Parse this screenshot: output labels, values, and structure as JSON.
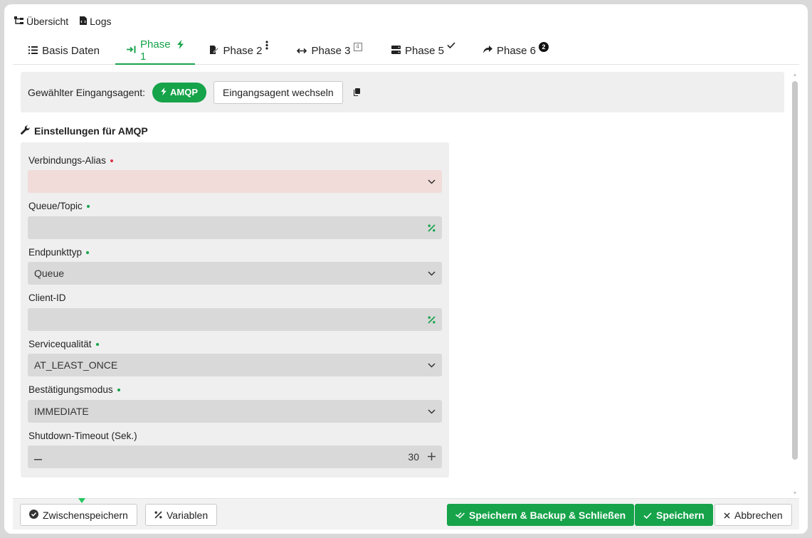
{
  "topnav": {
    "overview_label": "Übersicht",
    "logs_label": "Logs"
  },
  "tabs": [
    {
      "label": "Basis Daten",
      "icon": "list-icon",
      "active": false
    },
    {
      "label": "Phase 1",
      "icon": "arrow-to-right-icon",
      "badge_icon": "bolt-icon",
      "active": true
    },
    {
      "label": "Phase 2",
      "icon": "file-edit-icon",
      "badge_icon": "vertical-dots-icon",
      "active": false
    },
    {
      "label": "Phase 3",
      "icon": "arrows-horizontal-icon",
      "badge": "4",
      "active": false
    },
    {
      "label": "Phase 5",
      "icon": "server-icon",
      "badge_icon": "check-icon",
      "active": false
    },
    {
      "label": "Phase 6",
      "icon": "share-arrow-icon",
      "badge": "2",
      "active": false
    }
  ],
  "agent": {
    "label": "Gewählter Eingangsagent:",
    "pill": "AMQP",
    "switch_button": "Eingangsagent wechseln"
  },
  "settings": {
    "title": "Einstellungen für AMQP",
    "fields": [
      {
        "label": "Verbindungs-Alias",
        "required_color": "#dc3545",
        "value": "",
        "type": "select",
        "error": true
      },
      {
        "label": "Queue/Topic",
        "required_color": "#16a34a",
        "value": "",
        "type": "variable"
      },
      {
        "label": "Endpunkttyp",
        "required_color": "#16a34a",
        "value": "Queue",
        "type": "select"
      },
      {
        "label": "Client-ID",
        "required_color": "",
        "value": "",
        "type": "variable"
      },
      {
        "label": "Servicequalität",
        "required_color": "#16a34a",
        "value": "AT_LEAST_ONCE",
        "type": "select"
      },
      {
        "label": "Bestätigungsmodus",
        "required_color": "#16a34a",
        "value": "IMMEDIATE",
        "type": "select"
      },
      {
        "label": "Shutdown-Timeout (Sek.)",
        "required_color": "",
        "value": "30",
        "type": "stepper"
      }
    ]
  },
  "footer": {
    "save_draft": "Zwischenspeichern",
    "variables": "Variablen",
    "save_backup_close": "Speichern & Backup & Schließen",
    "save": "Speichern",
    "cancel": "Abbrechen"
  },
  "colors": {
    "accent": "#16a34a",
    "error_field": "#f1dcd9",
    "panel": "#efefef"
  }
}
